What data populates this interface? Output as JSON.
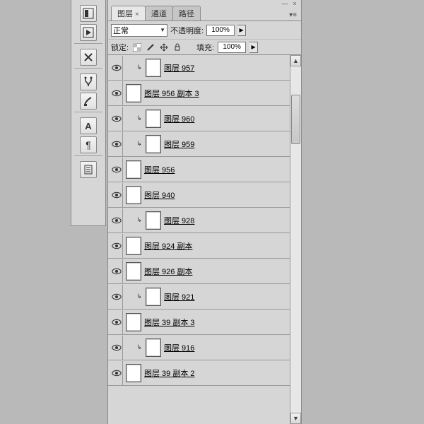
{
  "tabs": [
    {
      "label": "图层",
      "active": true,
      "closable": true
    },
    {
      "label": "通道",
      "active": false,
      "closable": false
    },
    {
      "label": "路径",
      "active": false,
      "closable": false
    }
  ],
  "blend": {
    "value": "正常"
  },
  "opacity": {
    "label": "不透明度:",
    "value": "100%"
  },
  "lock": {
    "label": "锁定:"
  },
  "fill": {
    "label": "填充:",
    "value": "100%"
  },
  "layers": [
    {
      "clip": true,
      "name": "图层 957"
    },
    {
      "clip": false,
      "name": "图层 956 副本 3"
    },
    {
      "clip": true,
      "name": "图层 960"
    },
    {
      "clip": true,
      "name": "图层 959"
    },
    {
      "clip": false,
      "name": "图层 956"
    },
    {
      "clip": false,
      "name": "图层 940"
    },
    {
      "clip": true,
      "name": "图层 928"
    },
    {
      "clip": false,
      "name": "图层 924 副本"
    },
    {
      "clip": false,
      "name": "图层 926 副本"
    },
    {
      "clip": true,
      "name": "图层 921"
    },
    {
      "clip": false,
      "name": "图层 39 副本 3"
    },
    {
      "clip": true,
      "name": "图层 916"
    },
    {
      "clip": false,
      "name": "图层 39 副本 2"
    }
  ]
}
